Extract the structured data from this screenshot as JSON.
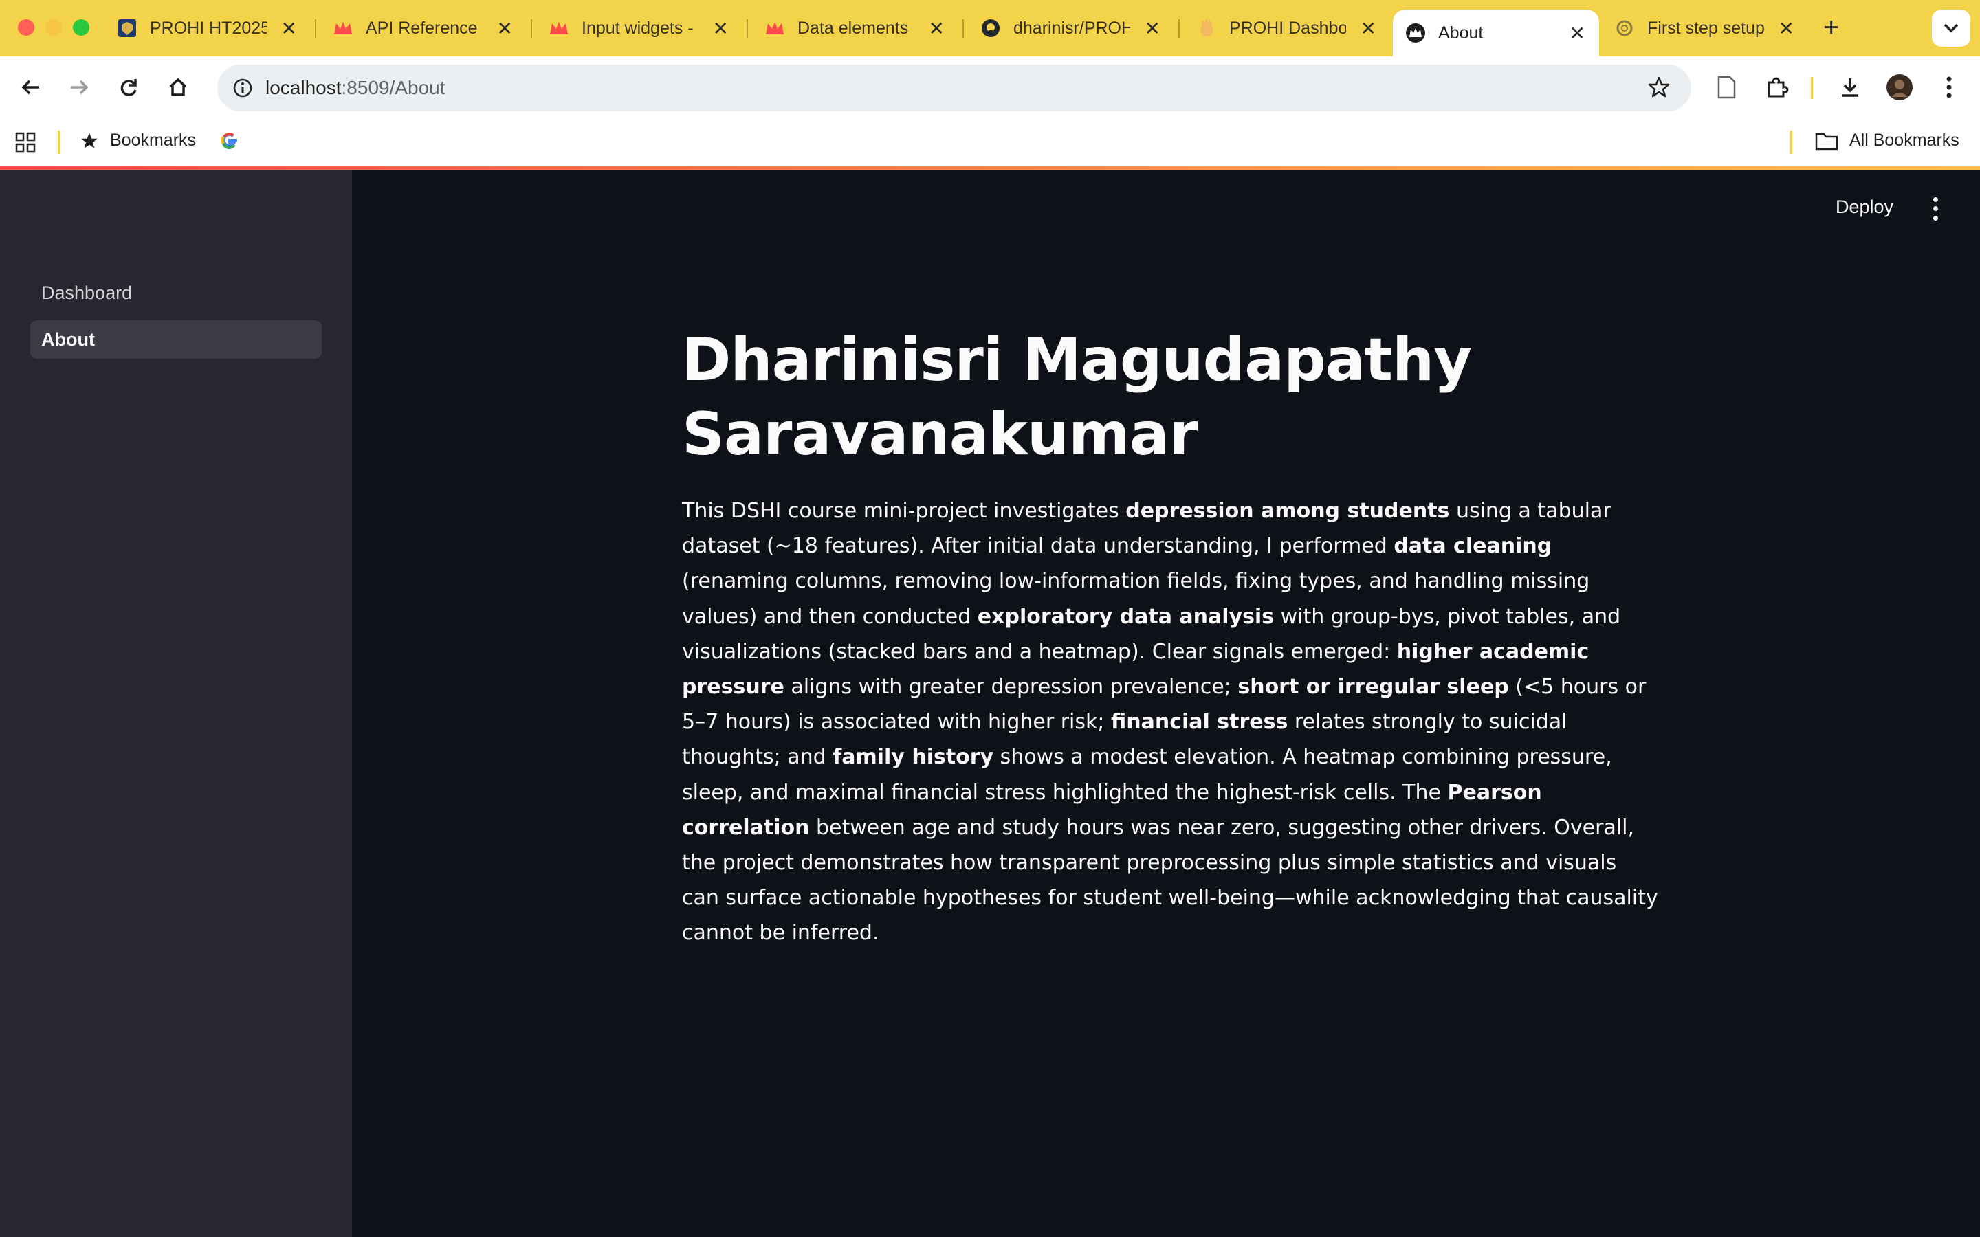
{
  "browser": {
    "tabs": [
      {
        "title": "PROHI HT2025",
        "icon": "university-crest-icon"
      },
      {
        "title": "API Reference -",
        "icon": "streamlit-crown-icon"
      },
      {
        "title": "Input widgets -",
        "icon": "streamlit-crown-icon"
      },
      {
        "title": "Data elements",
        "icon": "streamlit-crown-icon"
      },
      {
        "title": "dharinisr/PROHI",
        "icon": "github-icon"
      },
      {
        "title": "PROHI Dashbo",
        "icon": "waving-hand-icon"
      },
      {
        "title": "About",
        "icon": "streamlit-crown-icon",
        "active": true
      },
      {
        "title": "First step setup",
        "icon": "openai-icon"
      }
    ],
    "url_host": "localhost",
    "url_rest": ":8509/About",
    "bookmarks_label": "Bookmarks",
    "all_bookmarks_label": "All Bookmarks",
    "accent_color": "#f3d34a"
  },
  "app": {
    "deploy_label": "Deploy",
    "sidebar": {
      "items": [
        {
          "label": "Dashboard",
          "active": false
        },
        {
          "label": "About",
          "active": true
        }
      ]
    },
    "title": "Dharinisri Magudapathy Saravanakumar",
    "paragraph": [
      {
        "t": "This DSHI course mini-project investigates "
      },
      {
        "t": "depression among students",
        "b": true
      },
      {
        "t": " using a tabular dataset (~18 features). After initial data understanding, I performed "
      },
      {
        "t": "data cleaning",
        "b": true
      },
      {
        "t": " (renaming columns, removing low-information fields, fixing types, and handling missing values) and then conducted "
      },
      {
        "t": "exploratory data analysis",
        "b": true
      },
      {
        "t": " with group-bys, pivot tables, and visualizations (stacked bars and a heatmap). Clear signals emerged: "
      },
      {
        "t": "higher academic pressure",
        "b": true
      },
      {
        "t": " aligns with greater depression prevalence; "
      },
      {
        "t": "short or irregular sleep",
        "b": true
      },
      {
        "t": " (<5 hours or 5–7 hours) is associated with higher risk; "
      },
      {
        "t": "financial stress",
        "b": true
      },
      {
        "t": " relates strongly to suicidal thoughts; and "
      },
      {
        "t": "family history",
        "b": true
      },
      {
        "t": " shows a modest elevation. A heatmap combining pressure, sleep, and maximal financial stress highlighted the highest-risk cells. The "
      },
      {
        "t": "Pearson correlation",
        "b": true
      },
      {
        "t": " between age and study hours was near zero, suggesting other drivers. Overall, the project demonstrates how transparent preprocessing plus simple statistics and visuals can surface actionable hypotheses for student well-being—while acknowledging that causality cannot be inferred."
      }
    ]
  }
}
